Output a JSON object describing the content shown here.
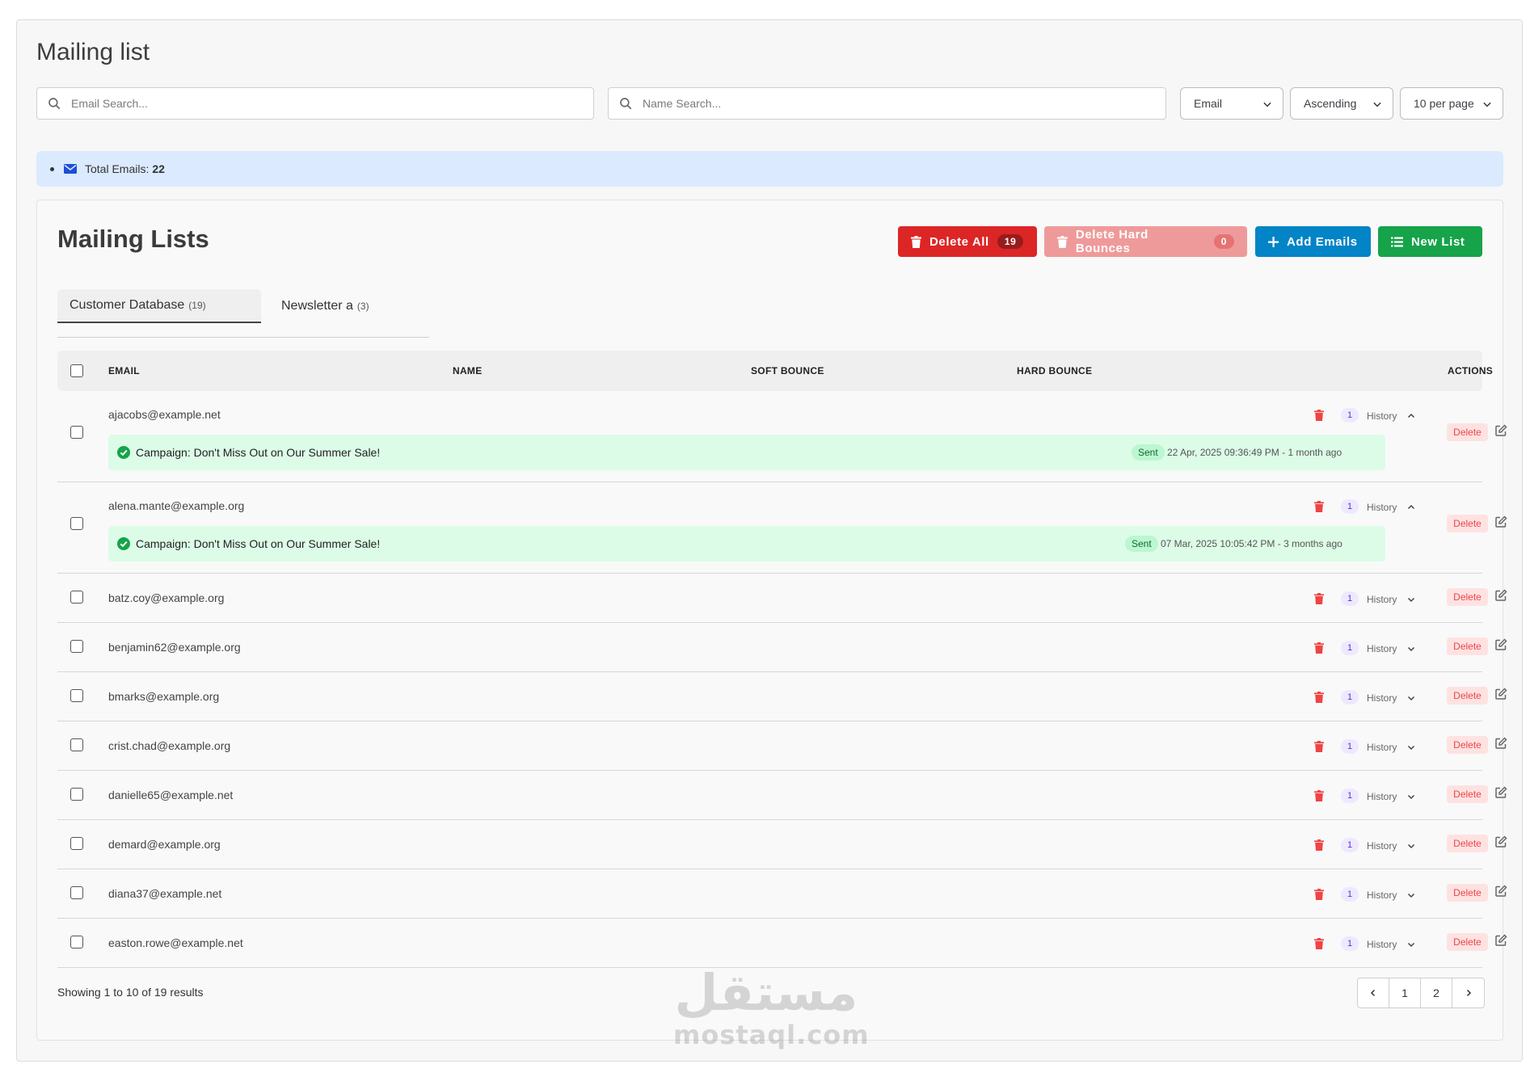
{
  "page": {
    "title": "Mailing list"
  },
  "filters": {
    "email_search_placeholder": "Email Search...",
    "name_search_placeholder": "Name Search...",
    "sort_field": "Email",
    "sort_order": "Ascending",
    "per_page": "10 per page"
  },
  "summary": {
    "label": "Total Emails:",
    "value": "22"
  },
  "card": {
    "title": "Mailing Lists",
    "actions": {
      "delete_all": "Delete All",
      "delete_all_count": "19",
      "delete_hard_bounces": "Delete Hard Bounces",
      "delete_hard_bounces_count": "0",
      "add_emails": "Add Emails",
      "new_list": "New List"
    },
    "tabs": [
      {
        "label": "Customer Database",
        "count": "(19)"
      },
      {
        "label": "Newsletter a",
        "count": "(3)"
      }
    ],
    "columns": [
      "EMAIL",
      "NAME",
      "SOFT BOUNCE",
      "HARD BOUNCE",
      "ACTIONS"
    ],
    "history_label": "History",
    "delete_label": "Delete",
    "rows": [
      {
        "email": "ajacobs@example.net",
        "history_count": "1",
        "campaign": "Campaign: Don't Miss Out on Our Summer Sale!",
        "status": "Sent",
        "sent_at": "22 Apr, 2025 09:36:49 PM - 1 month ago"
      },
      {
        "email": "alena.mante@example.org",
        "history_count": "1",
        "campaign": "Campaign: Don't Miss Out on Our Summer Sale!",
        "status": "Sent",
        "sent_at": "07 Mar, 2025 10:05:42 PM - 3 months ago"
      },
      {
        "email": "batz.coy@example.org",
        "history_count": "1"
      },
      {
        "email": "benjamin62@example.org",
        "history_count": "1"
      },
      {
        "email": "bmarks@example.org",
        "history_count": "1"
      },
      {
        "email": "crist.chad@example.org",
        "history_count": "1"
      },
      {
        "email": "danielle65@example.net",
        "history_count": "1"
      },
      {
        "email": "demard@example.org",
        "history_count": "1"
      },
      {
        "email": "diana37@example.net",
        "history_count": "1"
      },
      {
        "email": "easton.rowe@example.net",
        "history_count": "1"
      }
    ],
    "footer": {
      "showing": "Showing 1 to 10 of 19 results"
    },
    "pagination": {
      "pages": [
        "1",
        "2"
      ]
    }
  },
  "watermark": {
    "arabic": "مستقل",
    "latin": "mostaql.com"
  },
  "colors": {
    "danger": "#dc2626",
    "primary": "#0284c7",
    "success": "#16a34a",
    "info_bg": "#dbeafe",
    "campaign_bg": "#dcfce7"
  }
}
